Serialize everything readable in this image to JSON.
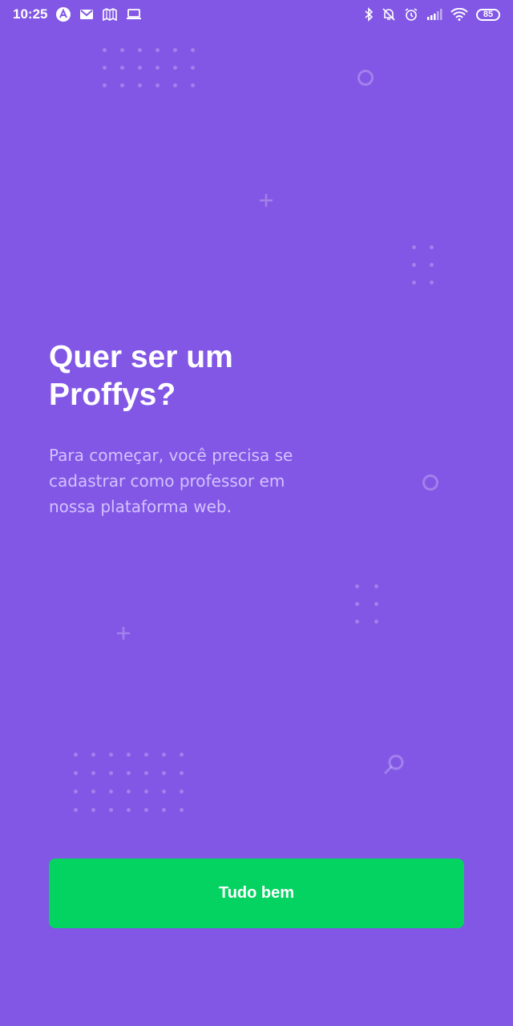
{
  "status_bar": {
    "time": "10:25",
    "battery": "85",
    "left_icons": [
      "app-a-icon",
      "gmail-icon",
      "maps-icon",
      "laptop-icon"
    ],
    "right_icons": [
      "bluetooth-icon",
      "notifications-off-icon",
      "alarm-icon",
      "signal-icon",
      "wifi-icon",
      "battery-icon"
    ]
  },
  "screen": {
    "title_line1": "Quer ser um",
    "title_line2": "Proffys?",
    "description_line1": "Para começar, você precisa se",
    "description_line2": "cadastrar como professor em",
    "description_line3": "nossa plataforma web."
  },
  "button": {
    "label": "Tudo bem"
  },
  "colors": {
    "background": "#8257E5",
    "button": "#04D361",
    "description": "#D4C2FF",
    "title": "#FFFFFF"
  }
}
